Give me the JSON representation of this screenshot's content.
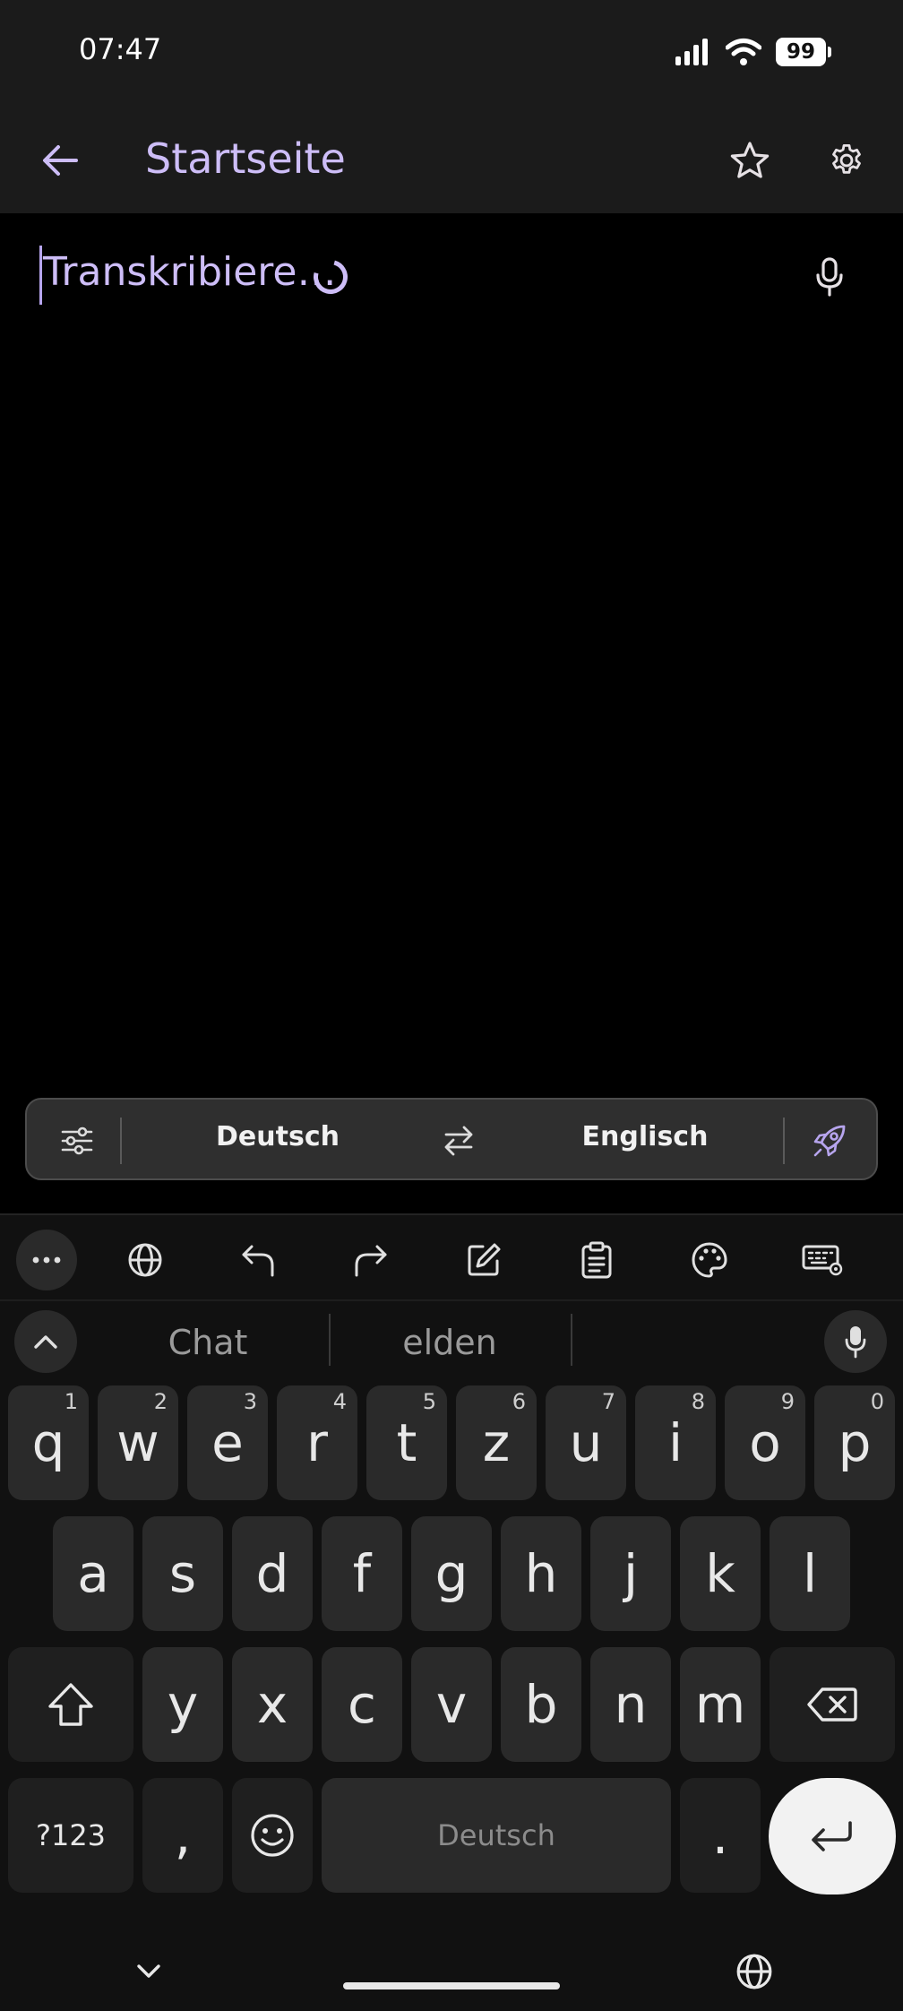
{
  "status_bar": {
    "time": "07:47",
    "battery": "99"
  },
  "app_bar": {
    "title": "Startseite"
  },
  "editor": {
    "status_text": "Transkribiere…"
  },
  "translate_bar": {
    "source_language": "Deutsch",
    "target_language": "Englisch"
  },
  "keyboard": {
    "suggestions": [
      "Chat",
      "elden"
    ],
    "rows": [
      [
        {
          "key": "q",
          "hint": "1"
        },
        {
          "key": "w",
          "hint": "2"
        },
        {
          "key": "e",
          "hint": "3"
        },
        {
          "key": "r",
          "hint": "4"
        },
        {
          "key": "t",
          "hint": "5"
        },
        {
          "key": "z",
          "hint": "6"
        },
        {
          "key": "u",
          "hint": "7"
        },
        {
          "key": "i",
          "hint": "8"
        },
        {
          "key": "o",
          "hint": "9"
        },
        {
          "key": "p",
          "hint": "0"
        }
      ],
      [
        {
          "key": "a"
        },
        {
          "key": "s"
        },
        {
          "key": "d"
        },
        {
          "key": "f"
        },
        {
          "key": "g"
        },
        {
          "key": "h"
        },
        {
          "key": "j"
        },
        {
          "key": "k"
        },
        {
          "key": "l"
        }
      ],
      [
        {
          "key": "y"
        },
        {
          "key": "x"
        },
        {
          "key": "c"
        },
        {
          "key": "v"
        },
        {
          "key": "b"
        },
        {
          "key": "n"
        },
        {
          "key": "m"
        }
      ]
    ],
    "symbols_key": "?123",
    "comma_key": ",",
    "space_label": "Deutsch",
    "period_key": "."
  },
  "colors": {
    "accent": "#cdbdf7",
    "background": "#000000",
    "surface": "#1b1b1b",
    "key": "#2a2a2a"
  },
  "icons": {
    "app_bar": [
      "arrow-left-icon",
      "star-icon",
      "gear-icon"
    ],
    "toolbar": [
      "more-icon",
      "globe-icon",
      "undo-icon",
      "redo-icon",
      "edit-icon",
      "clipboard-icon",
      "palette-icon",
      "keyboard-settings-icon"
    ]
  }
}
